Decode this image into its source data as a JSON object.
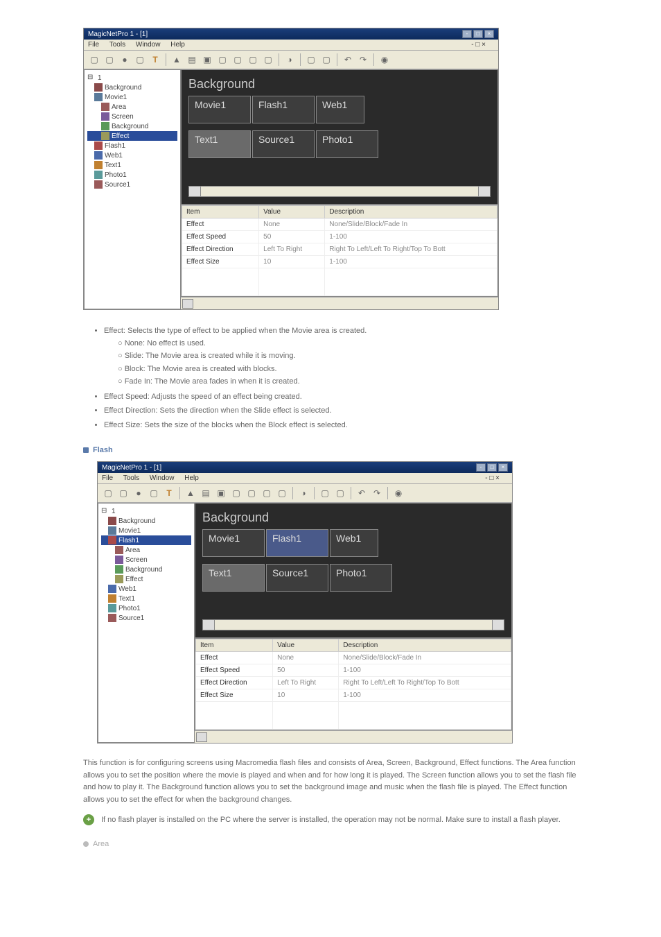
{
  "screenshot1": {
    "title": "MagicNetPro 1 - [1]",
    "menu": {
      "file": "File",
      "tools": "Tools",
      "window": "Window",
      "help": "Help"
    },
    "winctrl": "- □ ×",
    "tree": {
      "bg": "Background",
      "movie": "Movie1",
      "area": "Area",
      "screen": "Screen",
      "background": "Background",
      "effect": "Effect",
      "flash": "Flash1",
      "web": "Web1",
      "text": "Text1",
      "photo": "Photo1",
      "source": "Source1"
    },
    "canvas": {
      "title": "Background",
      "movie": "Movie1",
      "flash": "Flash1",
      "web": "Web1",
      "text": "Text1",
      "source": "Source1",
      "photo": "Photo1"
    },
    "grid": {
      "h_item": "Item",
      "h_value": "Value",
      "h_desc": "Description",
      "r1": {
        "item": "Effect",
        "value": "None",
        "desc": "None/Slide/Block/Fade In"
      },
      "r2": {
        "item": "Effect Speed",
        "value": "50",
        "desc": "1-100"
      },
      "r3": {
        "item": "Effect Direction",
        "value": "Left To Right",
        "desc": "Right To Left/Left To Right/Top To Bott"
      },
      "r4": {
        "item": "Effect Size",
        "value": "10",
        "desc": "1-100"
      }
    }
  },
  "list1": {
    "effect": "Effect: Selects the type of effect to be applied when the Movie area is created.",
    "none": "None: No effect is used.",
    "slide": "Slide: The Movie area is created while it is moving.",
    "block": "Block: The Movie area is created with blocks.",
    "fadein": "Fade In: The Movie area fades in when it is created.",
    "speed": "Effect Speed: Adjusts the speed of an effect being created.",
    "direction": "Effect Direction: Sets the direction when the Slide effect is selected.",
    "size": "Effect Size: Sets the size of the blocks when the Block effect is selected."
  },
  "heading_flash": "Flash",
  "screenshot2": {
    "title": "MagicNetPro 1 - [1]",
    "menu": {
      "file": "File",
      "tools": "Tools",
      "window": "Window",
      "help": "Help"
    },
    "winctrl": "- □ ×",
    "tree": {
      "bg": "Background",
      "movie": "Movie1",
      "flash": "Flash1",
      "area": "Area",
      "screen": "Screen",
      "background": "Background",
      "effect": "Effect",
      "web": "Web1",
      "text": "Text1",
      "photo": "Photo1",
      "source": "Source1"
    },
    "canvas": {
      "title": "Background",
      "movie": "Movie1",
      "flash": "Flash1",
      "web": "Web1",
      "text": "Text1",
      "source": "Source1",
      "photo": "Photo1"
    },
    "grid": {
      "h_item": "Item",
      "h_value": "Value",
      "h_desc": "Description",
      "r1": {
        "item": "Effect",
        "value": "None",
        "desc": "None/Slide/Block/Fade In"
      },
      "r2": {
        "item": "Effect Speed",
        "value": "50",
        "desc": "1-100"
      },
      "r3": {
        "item": "Effect Direction",
        "value": "Left To Right",
        "desc": "Right To Left/Left To Right/Top To Bott"
      },
      "r4": {
        "item": "Effect Size",
        "value": "10",
        "desc": "1-100"
      }
    }
  },
  "desc_flash": "This function is for configuring screens using Macromedia flash files and consists of Area, Screen, Background, Effect functions. The Area function allows you to set the position where the movie is played and when and for how long it is played. The Screen function allows you to set the flash file and how to play it. The Background function allows you to set the background image and music when the flash file is played. The Effect function allows you to set the effect for when the background changes.",
  "note": "If no flash player is installed on the PC where the server is installed, the operation may not be normal. Make sure to install a flash player.",
  "sub_area": "Area"
}
